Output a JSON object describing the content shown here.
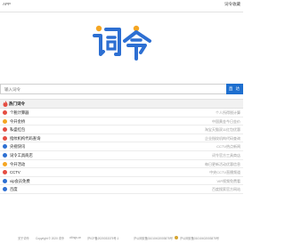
{
  "header": {
    "app_label": "APP",
    "collect_label": "词令收藏"
  },
  "logo": {
    "text": "词令",
    "colors": {
      "primary": "#2d6fd2",
      "accent": "#f5a623"
    }
  },
  "search": {
    "placeholder": "输入词令",
    "button_label": "直 达"
  },
  "hot": {
    "title": "热门词令",
    "items": [
      {
        "name": "个税计算器",
        "desc": "个人所得税计算",
        "icon": "calculator-icon",
        "color": "#e54d42"
      },
      {
        "name": "今开金桥",
        "desc": "中国黄金今日金价",
        "icon": "gold-icon",
        "color": "#f5a623"
      },
      {
        "name": "私盛红包",
        "desc": "淘宝天猫双11红包优惠",
        "icon": "red-packet-icon",
        "color": "#e54d42"
      },
      {
        "name": "指纹机构代码查询",
        "desc": "企业指纹机构代码查询",
        "icon": "fingerprint-icon",
        "color": "#e54d42"
      },
      {
        "name": "央视快讯",
        "desc": "CCTV热点新闻",
        "icon": "news-icon",
        "color": "#2d6fd2"
      },
      {
        "name": "词令工具商店",
        "desc": "词令官方工具商店",
        "icon": "shop-icon",
        "color": "#2d6fd2"
      },
      {
        "name": "今开活动",
        "desc": "每日更新活动优惠信息",
        "icon": "activity-icon",
        "color": "#f5a623"
      },
      {
        "name": "CCTV",
        "desc": "中央CCTV直播频道",
        "icon": "tv-icon",
        "color": "#e54d42"
      },
      {
        "name": "vip会员免费",
        "desc": "VIP视频免费看",
        "icon": "vip-icon",
        "color": "#2d6fd2"
      },
      {
        "name": "百度",
        "desc": "百度搜索官方网站",
        "icon": "baidu-icon",
        "color": "#2d6fd2"
      }
    ]
  },
  "footer": {
    "about": "关于词令",
    "copyright": "Copyright © 2020 词令",
    "domain": "cilings.cn",
    "icp": "沪ICP备2020033375号-1",
    "license": "沪公网安备31010402003875号",
    "police": "沪公网安备31010402003875号"
  }
}
